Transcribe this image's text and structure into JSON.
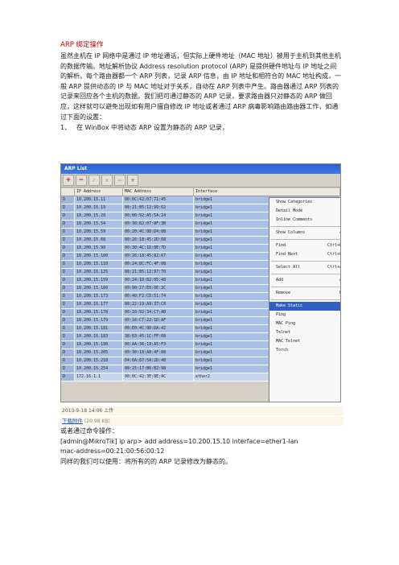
{
  "doc": {
    "title": "ARP 绑定操作",
    "intro": "虽然主机在 IP 网络中是通过 IP 地址通话，但实际上硬件地址（MAC 地址）被用于主机到其他主机的数据传输。地址解析协议 Address resolution protocol (ARP) 是提供硬件地址与 IP 地址之间的解析。每个路由器都一个 ARP 列表，记录 ARP 信息，由 IP 地址和相符合的 MAC 地址构成，一般 ARP 提供动态的 IP 与 MAC 地址对于关系，自动在 ARP 列表中产生。路由器通过 ARP 列表的记录来回应各个主机的数据，我们把可通过静态的 ARP 记录，要求路由器只对静态的 ARP 做回应，这样就可以避免出现如有用户擅自修改 IP 地址或者通过 ARP 病毒影响路由路由器工作，如通过下面的设置：",
    "step_num": "1、",
    "step_text": "在 WinBox 中将动态 ARP 设置为静态的 ARP 记录，"
  },
  "window": {
    "title": "ARP List",
    "toolbar": {
      "add": "+",
      "remove": "−",
      "enable": "✓",
      "disable": "✕",
      "comment": "▭",
      "filter": "▼"
    },
    "columns": [
      "",
      "IP Address",
      "MAC Address",
      "Interface"
    ],
    "rows": [
      {
        "flag": "D",
        "ip": "10.200.15.11",
        "mac": "00:0C:42:07:71:45",
        "iface": "bridge1"
      },
      {
        "flag": "D",
        "ip": "10.200.15.19",
        "mac": "00:21:85:12:99:62",
        "iface": "bridge1"
      },
      {
        "flag": "D",
        "ip": "10.200.15.20",
        "mac": "00:00:92:A5:5A:24",
        "iface": "bridge1"
      },
      {
        "flag": "D",
        "ip": "10.200.15.54",
        "mac": "00:30:82:07:8F:3B",
        "iface": "bridge1"
      },
      {
        "flag": "D",
        "ip": "10.200.15.59",
        "mac": "00:20:4C:0D:D4:08",
        "iface": "bridge1"
      },
      {
        "flag": "D",
        "ip": "10.200.15.68",
        "mac": "00:26:18:45:2D:68",
        "iface": "bridge1"
      },
      {
        "flag": "D",
        "ip": "10.200.15.99",
        "mac": "00:30:4C:1D:0E:7D",
        "iface": "bridge1"
      },
      {
        "flag": "D",
        "ip": "10.200.15.100",
        "mac": "00:26:18:45:82:67",
        "iface": "bridge1"
      },
      {
        "flag": "D",
        "ip": "10.200.15.110",
        "mac": "00:24:8C:FC:4F:08",
        "iface": "bridge1"
      },
      {
        "flag": "D",
        "ip": "10.200.15.125",
        "mac": "00:21:85:12:97:70",
        "iface": "bridge1"
      },
      {
        "flag": "D",
        "ip": "10.200.15.159",
        "mac": "00:24:1D:B2:05:48",
        "iface": "bridge1"
      },
      {
        "flag": "D",
        "ip": "10.200.15.160",
        "mac": "00:90:27:E0:0E:3C",
        "iface": "bridge1"
      },
      {
        "flag": "D",
        "ip": "10.200.15.173",
        "mac": "00:40:F2:CD:51:74",
        "iface": "bridge1"
      },
      {
        "flag": "D",
        "ip": "10.200.15.177",
        "mac": "00:22:19:A9:37:C8",
        "iface": "bridge1"
      },
      {
        "flag": "D",
        "ip": "10.200.15.178",
        "mac": "00:10:92:34:C7:AB",
        "iface": "bridge1"
      },
      {
        "flag": "D",
        "ip": "10.200.15.179",
        "mac": "00:16:C7:22:1D:AF",
        "iface": "bridge1"
      },
      {
        "flag": "D",
        "ip": "10.200.15.181",
        "mac": "00:E0:4C:0D:DA:42",
        "iface": "bridge1"
      },
      {
        "flag": "D",
        "ip": "10.200.15.183",
        "mac": "38:83:45:1C:FF:08",
        "iface": "bridge1"
      },
      {
        "flag": "D",
        "ip": "10.200.15.190",
        "mac": "00:AA:36:19:A5:F3",
        "iface": "bridge1"
      },
      {
        "flag": "D",
        "ip": "10.200.15.205",
        "mac": "00:30:18:A8:4F:88",
        "iface": "bridge1"
      },
      {
        "flag": "D",
        "ip": "10.200.15.218",
        "mac": "D4:6A:87:5A:2D:48",
        "iface": "bridge1"
      },
      {
        "flag": "D",
        "ip": "10.200.15.254",
        "mac": "00:15:17:B6:B2:98",
        "iface": "bridge1"
      },
      {
        "flag": "D",
        "ip": "172.16.1.1",
        "mac": "00:0C:42:3E:8E:AC",
        "iface": "ether2"
      }
    ],
    "context_menu": [
      {
        "label": "Show Categories",
        "shortcut": ""
      },
      {
        "label": "Detail Mode",
        "shortcut": ""
      },
      {
        "label": "Inline Comments",
        "shortcut": ""
      },
      {
        "sep": true
      },
      {
        "label": "Show Columns",
        "shortcut": "▸"
      },
      {
        "sep": true
      },
      {
        "label": "Find",
        "shortcut": "Ctrl+F"
      },
      {
        "label": "Find Next",
        "shortcut": "Ctrl+G"
      },
      {
        "sep": true
      },
      {
        "label": "Select All",
        "shortcut": "Ctrl+A"
      },
      {
        "sep": true
      },
      {
        "label": "Add",
        "shortcut": "A"
      },
      {
        "sep": true
      },
      {
        "label": "Remove",
        "shortcut": "R"
      },
      {
        "sep": true
      },
      {
        "label": "Make Static",
        "shortcut": "",
        "highlight": true
      },
      {
        "label": "Ping",
        "shortcut": ""
      },
      {
        "label": "MAC Ping",
        "shortcut": ""
      },
      {
        "label": "Telnet",
        "shortcut": ""
      },
      {
        "label": "MAC Telnet",
        "shortcut": ""
      },
      {
        "label": "Torch",
        "shortcut": ""
      }
    ]
  },
  "attachment": {
    "timestamp": "2013-9-18 14:06 上传",
    "download_label": "下载附件",
    "size": "(20.98 KB)"
  },
  "after": {
    "line1": "或者通过命令操作：",
    "cmd1": "[admin@MikroTik] ip arp> add address=10.200.15.10 interface=ether1-lan",
    "cmd2": "mac-address=00:21:00:56:00:12",
    "line2": "同样的我们可以使用：将所有的的 ARP 记录修改为静态的。"
  }
}
